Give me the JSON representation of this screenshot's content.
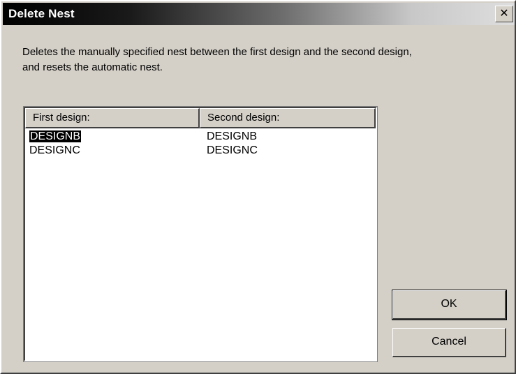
{
  "window": {
    "title": "Delete Nest",
    "close_glyph": "✕"
  },
  "description": "Deletes the manually specified nest between the first design and the second design, and resets the automatic nest.",
  "list": {
    "columns": [
      "First design:",
      "Second design:"
    ],
    "rows": [
      {
        "first": "DESIGNB",
        "second": "DESIGNB",
        "selected": true
      },
      {
        "first": "DESIGNC",
        "second": "DESIGNC",
        "selected": false
      }
    ]
  },
  "buttons": {
    "ok": "OK",
    "cancel": "Cancel"
  },
  "colors": {
    "face": "#d4d0c8",
    "selection": "#000000",
    "title_text": "#ffffff"
  }
}
